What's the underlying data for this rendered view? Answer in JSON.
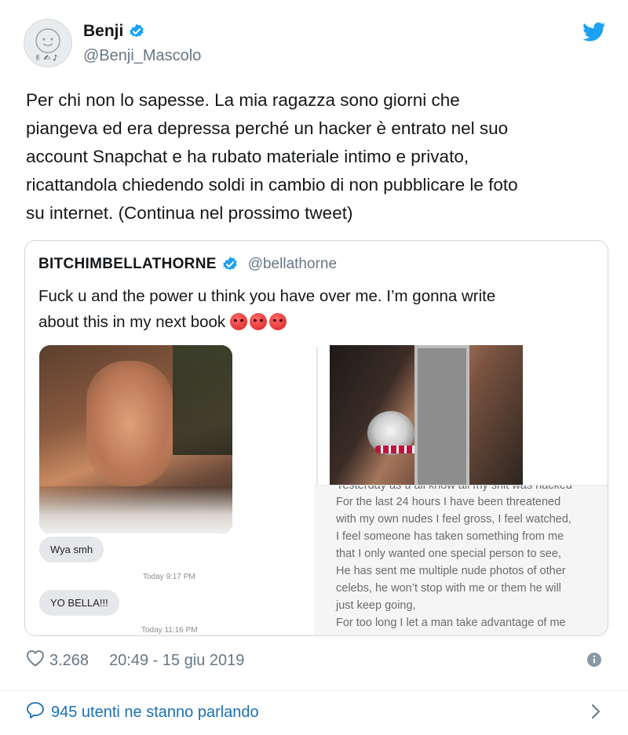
{
  "author": {
    "name": "Benji",
    "handle": "@Benji_Mascolo",
    "verified": true
  },
  "tweet": {
    "lines": [
      "Per chi non lo sapesse. La mia ragazza sono giorni che",
      "piangeva ed era depressa perché un hacker è entrato nel suo",
      "account Snapchat e ha rubato materiale intimo e privato,",
      "ricattandola chiedendo soldi in cambio di non pubblicare le foto",
      "su internet. (Continua nel prossimo tweet)"
    ]
  },
  "quoted": {
    "name": "BITCHIMBELLATHORNE",
    "handle": "@bellathorne",
    "verified": true,
    "text_line1": "Fuck u and the power u think you have over me. I’m gonna write",
    "text_line2": "about this in my next book",
    "media_left": {
      "bubbles": [
        "Wya smh",
        "YO BELLA!!!"
      ],
      "timestamps": [
        "Today 9:17 PM",
        "Today 11:16 PM"
      ]
    },
    "media_right": {
      "lines": [
        "Yesterday as u all know all my shit was hacked",
        "For the last 24 hours I have been threatened",
        "with my own nudes I feel gross, I feel watched,",
        "I feel someone has taken something from me",
        "that I only wanted one special person to see,",
        "He has sent me multiple nude photos of other",
        "celebs, he won’t stop with me or them he will",
        "just keep going,",
        "For too long I let a man take advantage of me"
      ]
    }
  },
  "footer": {
    "likes": "3.268",
    "timestamp": "20:49 - 15 giu 2019",
    "talking": "945 utenti ne stanno parlando"
  },
  "colors": {
    "twitter_blue": "#1da1f2",
    "link_blue": "#1b6fb5",
    "secondary_text": "#657786"
  }
}
